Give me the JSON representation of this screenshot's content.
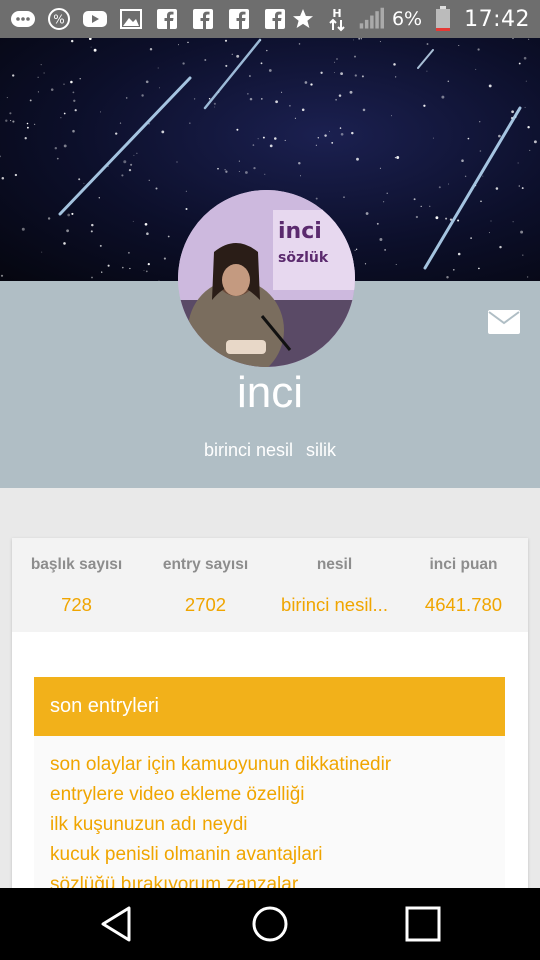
{
  "status_bar": {
    "icons": [
      "messages-icon",
      "percent-icon",
      "youtube-icon",
      "image-icon",
      "facebook-icon",
      "facebook-icon",
      "facebook-icon",
      "facebook-icon",
      "star-icon",
      "data-hplus-icon",
      "signal-icon"
    ],
    "battery_percent": "6%",
    "time": "17:42"
  },
  "profile": {
    "username": "inci",
    "generation": "birinci nesil",
    "status": "silik"
  },
  "stats": [
    {
      "label": "başlık sayısı",
      "value": "728"
    },
    {
      "label": "entry sayısı",
      "value": "2702"
    },
    {
      "label": "nesil",
      "value": "birinci nesil..."
    },
    {
      "label": "inci puan",
      "value": "4641.780"
    }
  ],
  "entries": {
    "header": "son entryleri",
    "items": [
      "son olaylar için kamuoyunun dikkatinedir",
      "entrylere video ekleme özelliği",
      "ilk kuşunuzun adı neydi",
      "kucuk penisli olmanin avantajlari",
      "sözlüğü bırakıyorum zanzalar"
    ]
  },
  "colors": {
    "accent": "#f2b11a",
    "band": "#b0bec5",
    "stat_value": "#f0a500"
  }
}
